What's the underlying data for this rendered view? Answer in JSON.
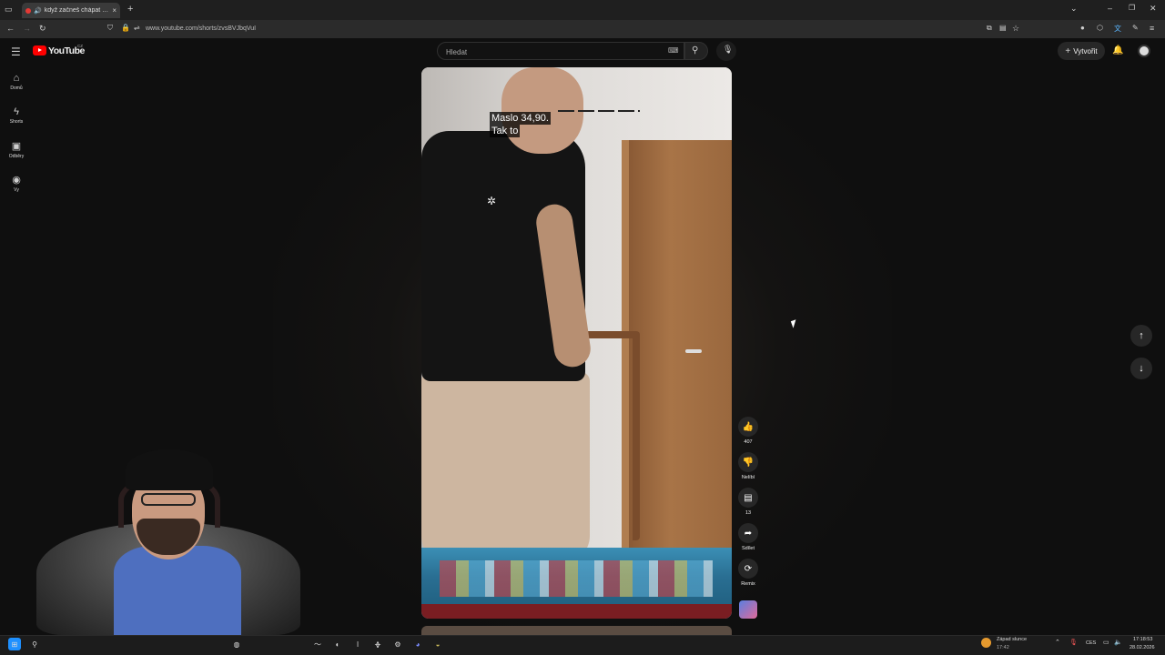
{
  "browser": {
    "tab_title": "když začneš chápat důchod",
    "url": "www.youtube.com/shorts/zvsBVJbqVuI",
    "icons": [
      "sidebar-toggle-icon",
      "speaker-icon",
      "tab-close-icon",
      "new-tab-icon",
      "back-icon",
      "forward-icon",
      "reload-icon",
      "shield-icon",
      "lock-icon",
      "site-info-icon",
      "bookmark-star-icon",
      "extensions-icon",
      "menu-icon"
    ]
  },
  "youtube": {
    "logo_text": "YouTube",
    "logo_region": "CZ",
    "search_placeholder": "Hledat",
    "create_label": "Vytvořit",
    "sidebar": [
      {
        "label": "Domů",
        "icon": "home-icon"
      },
      {
        "label": "Shorts",
        "icon": "shorts-icon"
      },
      {
        "label": "Odběry",
        "icon": "subscriptions-icon"
      },
      {
        "label": "Vy",
        "icon": "account-icon"
      }
    ]
  },
  "video": {
    "caption_line1": "Maslo 34,90.",
    "caption_line2": "Tak to"
  },
  "actions": {
    "likes": "407",
    "dislike_label": "Nelíbí",
    "comments": "13",
    "share_label": "Sdílet",
    "remix_label": "Remix"
  },
  "taskbar": {
    "weather_label": "Západ slunce",
    "weather_time": "17:42",
    "language": "CES",
    "clock_time": "17:18:53",
    "clock_date": "28.02.2026"
  },
  "colors": {
    "youtube_red": "#ff0000",
    "background": "#0f0f0f",
    "button_bg": "#272727"
  }
}
